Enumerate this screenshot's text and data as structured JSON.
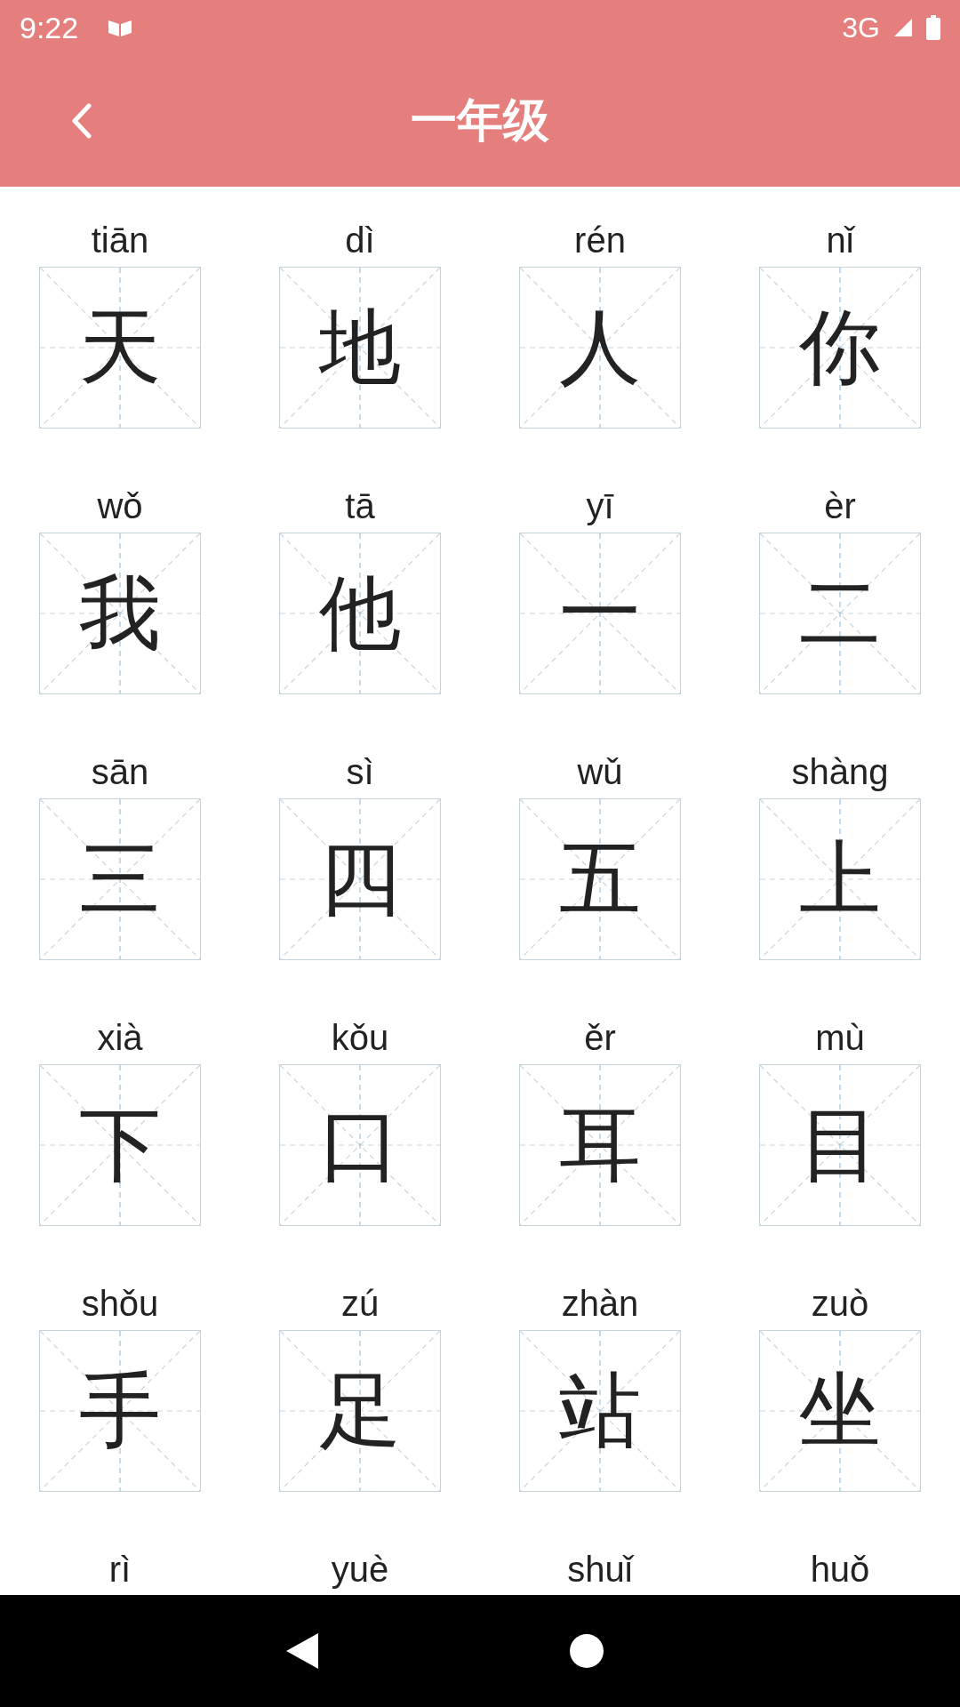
{
  "status_bar": {
    "time": "9:22",
    "network": "3G"
  },
  "app_bar": {
    "title": "一年级"
  },
  "characters": [
    {
      "pinyin": "tiān",
      "char": "天"
    },
    {
      "pinyin": "dì",
      "char": "地"
    },
    {
      "pinyin": "rén",
      "char": "人"
    },
    {
      "pinyin": "nǐ",
      "char": "你"
    },
    {
      "pinyin": "wǒ",
      "char": "我"
    },
    {
      "pinyin": "tā",
      "char": "他"
    },
    {
      "pinyin": "yī",
      "char": "一"
    },
    {
      "pinyin": "èr",
      "char": "二"
    },
    {
      "pinyin": "sān",
      "char": "三"
    },
    {
      "pinyin": "sì",
      "char": "四"
    },
    {
      "pinyin": "wǔ",
      "char": "五"
    },
    {
      "pinyin": "shàng",
      "char": "上"
    },
    {
      "pinyin": "xià",
      "char": "下"
    },
    {
      "pinyin": "kǒu",
      "char": "口"
    },
    {
      "pinyin": "ěr",
      "char": "耳"
    },
    {
      "pinyin": "mù",
      "char": "目"
    },
    {
      "pinyin": "shǒu",
      "char": "手"
    },
    {
      "pinyin": "zú",
      "char": "足"
    },
    {
      "pinyin": "zhàn",
      "char": "站"
    },
    {
      "pinyin": "zuò",
      "char": "坐"
    },
    {
      "pinyin": "rì"
    },
    {
      "pinyin": "yuè"
    },
    {
      "pinyin": "shuǐ"
    },
    {
      "pinyin": "huǒ"
    }
  ]
}
